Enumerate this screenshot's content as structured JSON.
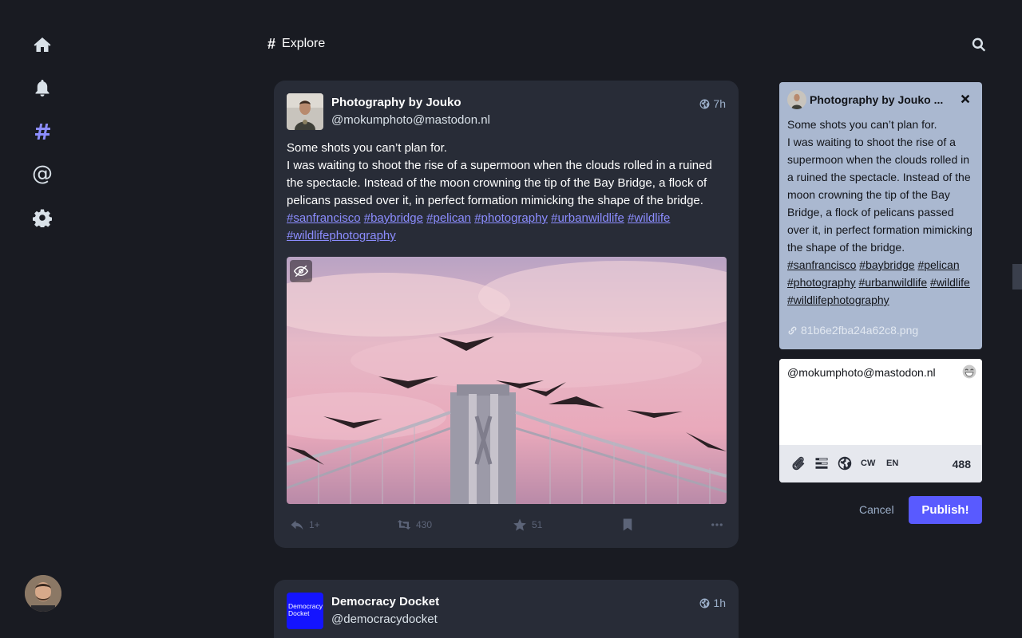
{
  "header": {
    "title": "Explore"
  },
  "nav": {
    "items": [
      {
        "icon": "home-icon"
      },
      {
        "icon": "bell-icon"
      },
      {
        "icon": "hashtag-icon",
        "active": true
      },
      {
        "icon": "at-icon",
        "glyph": "@"
      },
      {
        "icon": "gear-icon"
      }
    ]
  },
  "post1": {
    "name": "Photography by Jouko",
    "handle": "@mokumphoto@mastodon.nl",
    "time": "7h",
    "line1": "Some shots you can’t plan for.",
    "line2": "I was waiting to shoot the rise of a supermoon when the clouds rolled in a ruined the spectacle. Instead of the moon crowning the tip of the Bay Bridge, a flock of pelicans passed over it, in perfect formation mimicking the shape of the bridge.",
    "tags": [
      "#sanfrancisco",
      "#baybridge",
      "#pelican",
      "#photography",
      "#urbanwildlife",
      "#wildlife",
      "#wildlifephotography"
    ],
    "replies": "1+",
    "boosts": "430",
    "favourites": "51"
  },
  "post2": {
    "name": "Democracy Docket",
    "handle": "@democracydocket",
    "time": "1h",
    "logo_text": "Democracy Docket"
  },
  "compose": {
    "quote_name": "Photography by Jouko ...",
    "quote_line1": "Some shots you can’t plan for.",
    "quote_line2": "I was waiting to shoot the rise of a supermoon when the clouds rolled in a ruined the spectacle. Instead of the moon crowning the tip of the Bay Bridge, a flock of pelicans passed over it, in perfect formation mimicking the shape of the bridge.",
    "quote_file": "81b6e2fba24a62c8.png",
    "text": "@mokumphoto@mastodon.nl",
    "cw_label": "CW",
    "lang_label": "EN",
    "char_count": "488",
    "cancel_label": "Cancel",
    "publish_label": "Publish!"
  },
  "colors": {
    "accent": "#595aff",
    "link": "#8c8dff",
    "card": "#282c37",
    "background": "#191b22",
    "quote_bg": "#aab8d0"
  }
}
